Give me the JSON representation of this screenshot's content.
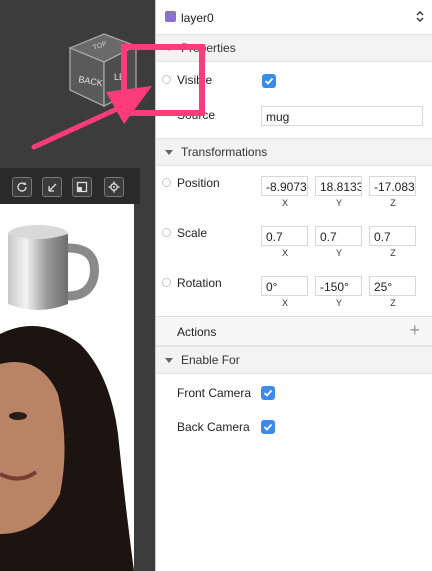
{
  "layer": {
    "name": "layer0",
    "color": "#8a6fd6"
  },
  "cube": {
    "label_back": "BACK",
    "label_top": "TOP",
    "label_side": "LE"
  },
  "toolbar": {
    "icons": [
      "refresh-icon",
      "resize-icon",
      "layout-icon",
      "gear-icon"
    ]
  },
  "properties": {
    "title": "Properties",
    "visible_label": "Visible",
    "visible_checked": true,
    "source_label": "Source",
    "source_value": "mug"
  },
  "transformations": {
    "title": "Transformations",
    "position": {
      "label": "Position",
      "x": "-8.9073",
      "y": "18.8133",
      "z": "-17.083"
    },
    "scale": {
      "label": "Scale",
      "x": "0.7",
      "y": "0.7",
      "z": "0.7"
    },
    "rotation": {
      "label": "Rotation",
      "x": "0°",
      "y": "-150°",
      "z": "25°"
    },
    "axes": {
      "x": "X",
      "y": "Y",
      "z": "Z"
    }
  },
  "actions": {
    "title": "Actions",
    "add_symbol": "+"
  },
  "enable_for": {
    "title": "Enable For",
    "front_camera": {
      "label": "Front Camera",
      "checked": true
    },
    "back_camera": {
      "label": "Back Camera",
      "checked": true
    }
  },
  "colors": {
    "accent": "#3b8beb",
    "highlight": "#ff3b7a"
  }
}
